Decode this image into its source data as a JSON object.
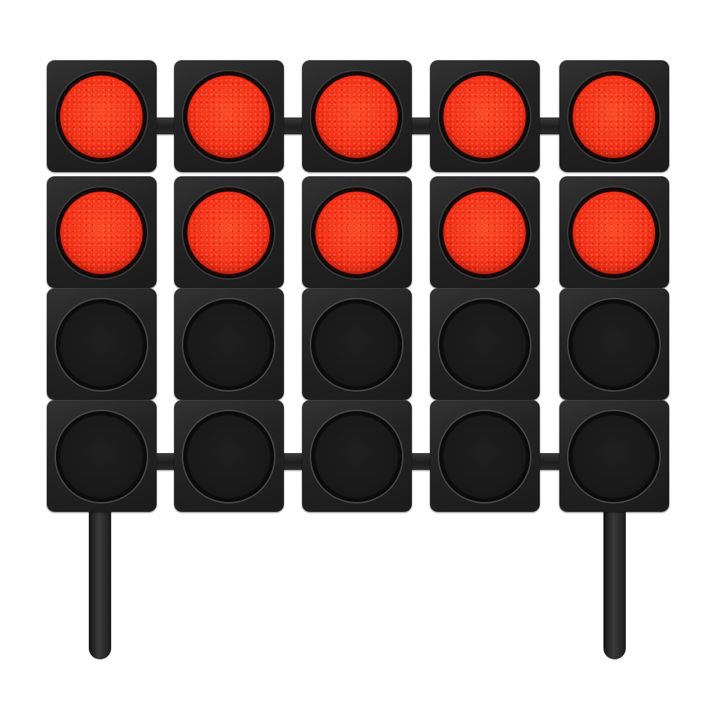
{
  "gantry": {
    "columns": [
      {
        "lamps": [
          "on",
          "on",
          "off",
          "off"
        ]
      },
      {
        "lamps": [
          "on",
          "on",
          "off",
          "off"
        ]
      },
      {
        "lamps": [
          "on",
          "on",
          "off",
          "off"
        ]
      },
      {
        "lamps": [
          "on",
          "on",
          "off",
          "off"
        ]
      },
      {
        "lamps": [
          "on",
          "on",
          "off",
          "off"
        ]
      }
    ],
    "lit_color": "#f53118",
    "unlit_color": "#1a1a1a",
    "housing_color": "#262626"
  }
}
